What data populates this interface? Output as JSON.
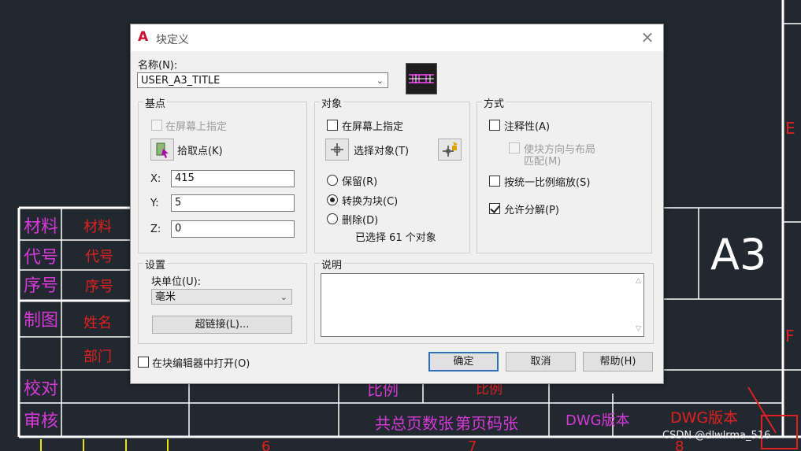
{
  "dialog": {
    "title": "块定义",
    "close_symbol": "×",
    "app_icon_letter": "A",
    "name_label": "名称(N):",
    "name_value": "USER_A3_TITLE",
    "base_point": {
      "title": "基点",
      "specify_on_screen": "在屏幕上指定",
      "pick_point": "拾取点(K)",
      "x_label": "X:",
      "x_value": "415",
      "y_label": "Y:",
      "y_value": "5",
      "z_label": "Z:",
      "z_value": "0"
    },
    "objects": {
      "title": "对象",
      "specify_on_screen": "在屏幕上指定",
      "select_objects": "选择对象(T)",
      "retain": "保留(R)",
      "convert_to_block": "转换为块(C)",
      "delete": "删除(D)",
      "selected_count": "已选择 61 个对象"
    },
    "behavior": {
      "title": "方式",
      "annotative": "注释性(A)",
      "match_orientation_line1": "使块方向与布局",
      "match_orientation_line2": "匹配(M)",
      "scale_uniformly": "按统一比例缩放(S)",
      "allow_exploding": "允许分解(P)"
    },
    "settings": {
      "title": "设置",
      "block_unit_label": "块单位(U):",
      "block_unit_value": "毫米",
      "hyperlink": "超链接(L)..."
    },
    "description": {
      "title": "说明"
    },
    "open_in_editor": "在块编辑器中打开(O)",
    "ok": "确定",
    "cancel": "取消",
    "help": "帮助(H)"
  },
  "background": {
    "left_table": [
      "材料",
      "代号",
      "序号",
      "制图",
      "校对",
      "审核"
    ],
    "mid_table": [
      "材料",
      "代号",
      "序号",
      "姓名",
      "部门"
    ],
    "bottom_row": [
      "比例",
      "比例",
      "共总页数张",
      "第页码张",
      "DWG版本",
      "DWG版本"
    ],
    "sheet_size": "A3",
    "zone_letters": [
      "E",
      "F"
    ],
    "bottom_numbers": [
      "6",
      "7",
      "8"
    ]
  },
  "watermark": "CSDN @dlwlrma_516",
  "colors": {
    "canvas": "#212830",
    "magenta_text": "#d63ad6",
    "red_text": "#e02020",
    "line": "#ffffff",
    "yellow_line": "#e6e600"
  }
}
